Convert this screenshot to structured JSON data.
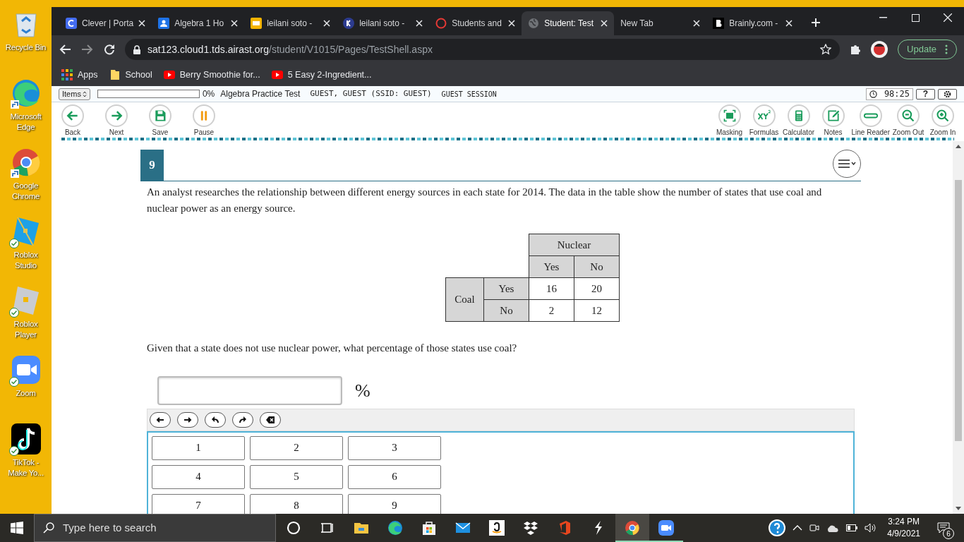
{
  "desktop_icons": [
    {
      "label": "Recycle Bin",
      "kind": "recycle",
      "synced": false,
      "shortcut": false
    },
    {
      "label": "Microsoft Edge",
      "kind": "edge",
      "synced": false,
      "shortcut": true
    },
    {
      "label": "Google Chrome",
      "kind": "chrome",
      "synced": false,
      "shortcut": true
    },
    {
      "label": "Roblox Studio",
      "kind": "roblox-studio",
      "synced": true,
      "shortcut": false
    },
    {
      "label": "Roblox Player",
      "kind": "roblox-player",
      "synced": true,
      "shortcut": false
    },
    {
      "label": "Zoom",
      "kind": "zoom",
      "synced": true,
      "shortcut": false
    },
    {
      "label": "TikTok - Make Yo...",
      "kind": "tiktok",
      "synced": true,
      "shortcut": false
    }
  ],
  "browser": {
    "tabs": [
      {
        "title": "Clever | Porta",
        "kind": "clever",
        "selected": false
      },
      {
        "title": "Algebra 1 Ho",
        "kind": "classroom",
        "selected": false
      },
      {
        "title": "leilani soto -",
        "kind": "slides",
        "selected": false
      },
      {
        "title": "leilani soto -",
        "kind": "k",
        "selected": false
      },
      {
        "title": "Students and",
        "kind": "ring",
        "selected": false
      },
      {
        "title": "Student: Test",
        "kind": "globe",
        "selected": true
      },
      {
        "title": "New Tab",
        "kind": "none",
        "selected": false
      },
      {
        "title": "Brainly.com -",
        "kind": "brainly",
        "selected": false
      }
    ],
    "address": {
      "host": "sat123.cloud1.tds.airast.org",
      "path": "/student/V1015/Pages/TestShell.aspx"
    },
    "update_button": "Update",
    "bookmarks": [
      {
        "label": "Apps",
        "kind": "apps"
      },
      {
        "label": "School",
        "kind": "folder"
      },
      {
        "label": "Berry Smoothie for...",
        "kind": "youtube"
      },
      {
        "label": "5 Easy 2-Ingredient...",
        "kind": "youtube"
      }
    ]
  },
  "test_bar": {
    "items_select": "Items",
    "progress": {
      "level": 0
    },
    "percent": "0%",
    "test_name": "Algebra Practice Test",
    "student": "GUEST, GUEST (SSID: GUEST)",
    "session": "GUEST SESSION",
    "timer": "98:25",
    "help": "?"
  },
  "nav_tools": [
    {
      "label": "Back",
      "kind": "back"
    },
    {
      "label": "Next",
      "kind": "next"
    },
    {
      "label": "Save",
      "kind": "save"
    },
    {
      "label": "Pause",
      "kind": "pause"
    }
  ],
  "tools": [
    {
      "label": "Masking",
      "kind": "masking"
    },
    {
      "label": "Formulas",
      "kind": "formulas"
    },
    {
      "label": "Calculator",
      "kind": "calculator"
    },
    {
      "label": "Notes",
      "kind": "notes"
    },
    {
      "label": "Line Reader",
      "kind": "line-reader"
    },
    {
      "label": "Zoom Out",
      "kind": "zoom-out"
    },
    {
      "label": "Zoom In",
      "kind": "zoom-in"
    }
  ],
  "question": {
    "number": "9",
    "text": "An analyst researches the relationship between different energy sources in each state for 2014. The data in the table show the number of states that use coal and nuclear power as an energy source.",
    "table": {
      "column_group": "Nuclear",
      "columns": [
        "Yes",
        "No"
      ],
      "row_group": "Coal",
      "rows": [
        {
          "label": "Yes",
          "cells": [
            "16",
            "20"
          ]
        },
        {
          "label": "No",
          "cells": [
            "2",
            "12"
          ]
        }
      ]
    },
    "prompt": "Given that a state does not use nuclear power, what percentage of those states use coal?",
    "unit": "%",
    "editor_buttons": [
      {
        "kind": "left"
      },
      {
        "kind": "right"
      },
      {
        "kind": "undo"
      },
      {
        "kind": "redo"
      },
      {
        "kind": "delete"
      }
    ],
    "keypad": [
      "1",
      "2",
      "3",
      "4",
      "5",
      "6",
      "7",
      "8",
      "9"
    ]
  },
  "taskbar": {
    "search_placeholder": "Type here to search",
    "apps": [
      {
        "kind": "cortana",
        "running": false
      },
      {
        "kind": "task-view",
        "running": false
      },
      {
        "kind": "folder",
        "running": false
      },
      {
        "kind": "edge",
        "running": false
      },
      {
        "kind": "store",
        "running": false
      },
      {
        "kind": "mail",
        "running": false
      },
      {
        "kind": "amazon",
        "running": false
      },
      {
        "kind": "dropbox",
        "running": false
      },
      {
        "kind": "office",
        "running": false
      },
      {
        "kind": "s-app",
        "running": false
      },
      {
        "kind": "chrome",
        "running": true
      },
      {
        "kind": "zoom",
        "running": true
      }
    ],
    "time": "3:24 PM",
    "date": "4/9/2021",
    "notifications": "6"
  }
}
